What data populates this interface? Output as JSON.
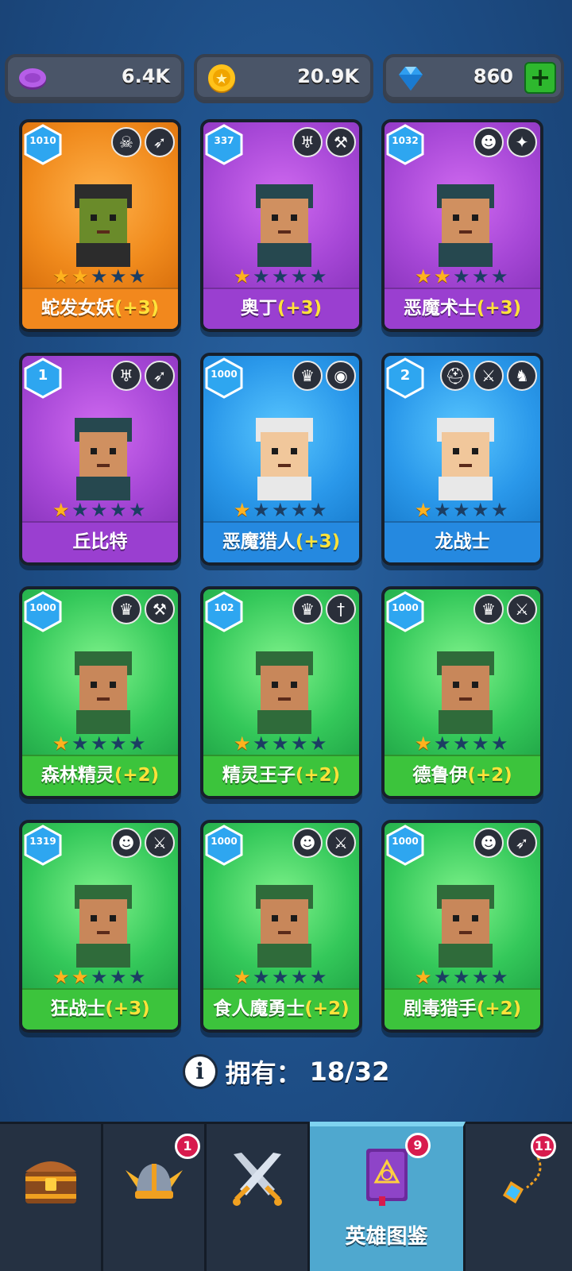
{
  "currency": {
    "purple": {
      "value": "6.4K",
      "icon": "purple-coin-icon"
    },
    "gold": {
      "value": "20.9K",
      "icon": "gold-coin-icon"
    },
    "gems": {
      "value": "860",
      "icon": "gem-icon",
      "add_icon": "plus-icon"
    }
  },
  "heroes": [
    {
      "name": "蛇发女妖",
      "bonus": "(+3)",
      "level": "1010",
      "stars": 2,
      "rarity": "orange",
      "traits": [
        "skull-icon",
        "bow-icon"
      ]
    },
    {
      "name": "奥丁",
      "bonus": "(+3)",
      "level": "337",
      "stars": 1,
      "rarity": "purple",
      "traits": [
        "wings-icon",
        "hammer-icon"
      ]
    },
    {
      "name": "恶魔术士",
      "bonus": "(+3)",
      "level": "1032",
      "stars": 2,
      "rarity": "purple",
      "traits": [
        "ogre-icon",
        "dagger-swirl-icon"
      ]
    },
    {
      "name": "丘比特",
      "bonus": "",
      "level": "1",
      "stars": 1,
      "rarity": "purple",
      "traits": [
        "wings-icon",
        "bow-icon"
      ]
    },
    {
      "name": "恶魔猎人",
      "bonus": "(+3)",
      "level": "1000",
      "stars": 1,
      "rarity": "blue",
      "traits": [
        "elf-icon",
        "eye-icon"
      ]
    },
    {
      "name": "龙战士",
      "bonus": "",
      "level": "2",
      "stars": 1,
      "rarity": "blue",
      "traits": [
        "helmet-icon",
        "sword-icon",
        "dragon-icon"
      ]
    },
    {
      "name": "森林精灵",
      "bonus": "(+2)",
      "level": "1000",
      "stars": 1,
      "rarity": "green",
      "traits": [
        "elf-icon",
        "hammer-icon"
      ]
    },
    {
      "name": "精灵王子",
      "bonus": "(+2)",
      "level": "102",
      "stars": 1,
      "rarity": "green",
      "traits": [
        "elf-icon",
        "dagger-icon"
      ]
    },
    {
      "name": "德鲁伊",
      "bonus": "(+2)",
      "level": "1000",
      "stars": 1,
      "rarity": "green",
      "traits": [
        "elf-icon",
        "sword-icon"
      ]
    },
    {
      "name": "狂战士",
      "bonus": "(+3)",
      "level": "1319",
      "stars": 2,
      "rarity": "green",
      "traits": [
        "ogre-icon",
        "sword-icon"
      ]
    },
    {
      "name": "食人魔勇士",
      "bonus": "(+2)",
      "level": "1000",
      "stars": 1,
      "rarity": "green",
      "traits": [
        "ogre-icon",
        "sword-icon"
      ]
    },
    {
      "name": "剧毒猎手",
      "bonus": "(+2)",
      "level": "1000",
      "stars": 1,
      "rarity": "green",
      "traits": [
        "ogre-icon",
        "bow-icon"
      ]
    }
  ],
  "owned": {
    "label": "拥有：",
    "value": "18/32",
    "icon": "info-icon"
  },
  "nav": [
    {
      "icon": "chest-icon",
      "label": "",
      "badge": ""
    },
    {
      "icon": "viking-helmet-icon",
      "label": "",
      "badge": "1"
    },
    {
      "icon": "crossed-swords-icon",
      "label": "",
      "badge": ""
    },
    {
      "icon": "spellbook-icon",
      "label": "英雄图鉴",
      "badge": "9"
    },
    {
      "icon": "amulet-icon",
      "label": "",
      "badge": "11"
    }
  ]
}
